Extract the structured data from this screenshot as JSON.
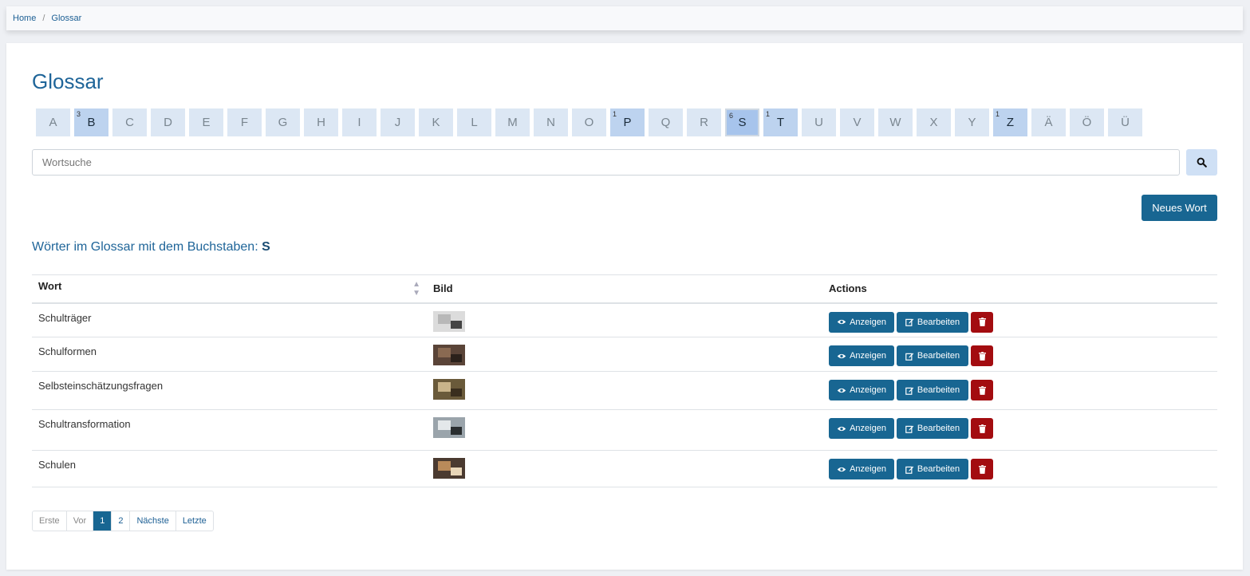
{
  "breadcrumb": {
    "home": "Home",
    "separator": "/",
    "current": "Glossar"
  },
  "title": "Glossar",
  "letters": [
    {
      "char": "A",
      "count": ""
    },
    {
      "char": "B",
      "count": "3"
    },
    {
      "char": "C",
      "count": ""
    },
    {
      "char": "D",
      "count": ""
    },
    {
      "char": "E",
      "count": ""
    },
    {
      "char": "F",
      "count": ""
    },
    {
      "char": "G",
      "count": ""
    },
    {
      "char": "H",
      "count": ""
    },
    {
      "char": "I",
      "count": ""
    },
    {
      "char": "J",
      "count": ""
    },
    {
      "char": "K",
      "count": ""
    },
    {
      "char": "L",
      "count": ""
    },
    {
      "char": "M",
      "count": ""
    },
    {
      "char": "N",
      "count": ""
    },
    {
      "char": "O",
      "count": ""
    },
    {
      "char": "P",
      "count": "1"
    },
    {
      "char": "Q",
      "count": ""
    },
    {
      "char": "R",
      "count": ""
    },
    {
      "char": "S",
      "count": "6",
      "active": true
    },
    {
      "char": "T",
      "count": "1"
    },
    {
      "char": "U",
      "count": ""
    },
    {
      "char": "V",
      "count": ""
    },
    {
      "char": "W",
      "count": ""
    },
    {
      "char": "X",
      "count": ""
    },
    {
      "char": "Y",
      "count": ""
    },
    {
      "char": "Z",
      "count": "1"
    },
    {
      "char": "Ä",
      "count": ""
    },
    {
      "char": "Ö",
      "count": ""
    },
    {
      "char": "Ü",
      "count": ""
    }
  ],
  "search": {
    "placeholder": "Wortsuche",
    "icon": "search-icon"
  },
  "new_word_label": "Neues Wort",
  "section": {
    "prefix": "Wörter im Glossar mit dem Buchstaben:",
    "letter": "S"
  },
  "table": {
    "headers": {
      "word": "Wort",
      "image": "Bild",
      "actions": "Actions"
    },
    "rows": [
      {
        "word": "Schulträger"
      },
      {
        "word": "Schulformen"
      },
      {
        "word": "Selbsteinschätzungsfragen"
      },
      {
        "word": "Schultransformation"
      },
      {
        "word": "Schulen"
      }
    ],
    "view_label": "Anzeigen",
    "edit_label": "Bearbeiten"
  },
  "pagination": {
    "first": "Erste",
    "prev": "Vor",
    "pages": [
      "1",
      "2"
    ],
    "current": "1",
    "next": "Nächste",
    "last": "Letzte"
  },
  "colors": {
    "primary": "#186692",
    "danger": "#a30c10",
    "title": "#1f6599"
  }
}
